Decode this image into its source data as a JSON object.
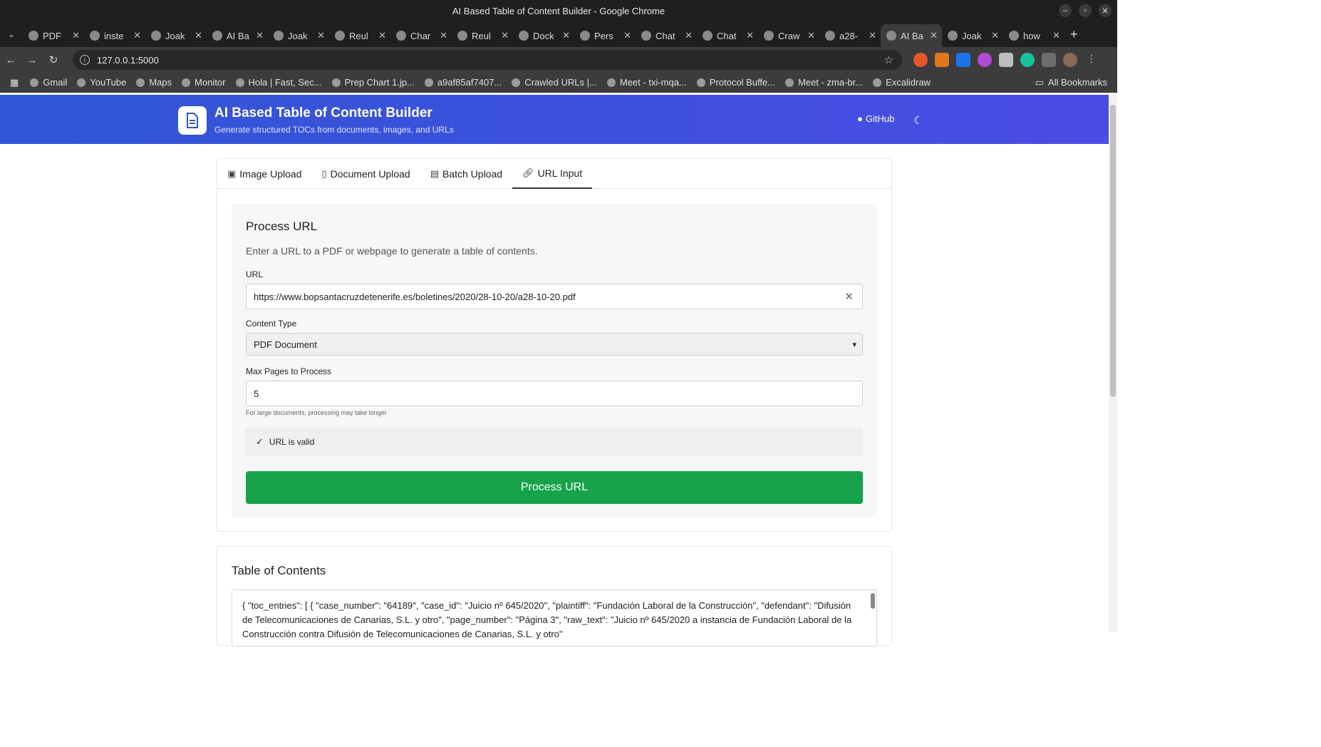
{
  "window": {
    "title": "AI Based Table of Content Builder - Google Chrome"
  },
  "tabs": [
    {
      "label": "PDF"
    },
    {
      "label": "inste"
    },
    {
      "label": "Joak"
    },
    {
      "label": "AI Ba"
    },
    {
      "label": "Joak"
    },
    {
      "label": "Reul"
    },
    {
      "label": "Char"
    },
    {
      "label": "Reul"
    },
    {
      "label": "Dock"
    },
    {
      "label": "Pers"
    },
    {
      "label": "Chat"
    },
    {
      "label": "Chat"
    },
    {
      "label": "Craw"
    },
    {
      "label": "a28-"
    },
    {
      "label": "AI Ba"
    },
    {
      "label": "Joak"
    },
    {
      "label": "how"
    }
  ],
  "active_tab_index": 14,
  "browser": {
    "url": "127.0.0.1:5000"
  },
  "bookmarks": [
    {
      "label": "Gmail"
    },
    {
      "label": "YouTube"
    },
    {
      "label": "Maps"
    },
    {
      "label": "Monitor"
    },
    {
      "label": "Hola | Fast, Sec..."
    },
    {
      "label": "Prep Chart 1.jp..."
    },
    {
      "label": "a9af85af7407..."
    },
    {
      "label": "Crawled URLs |..."
    },
    {
      "label": "Meet - txi-mqa..."
    },
    {
      "label": "Protocol Buffe..."
    },
    {
      "label": "Meet - zma-br..."
    },
    {
      "label": "Excalidraw"
    }
  ],
  "bookmarks_all": "All Bookmarks",
  "app": {
    "title": "AI Based Table of Content Builder",
    "subtitle": "Generate structured TOCs from documents, images, and URLs",
    "github": "GitHub",
    "accent": "#2f56d6"
  },
  "nav_tabs": [
    {
      "label": "Image Upload",
      "icon": "image-icon"
    },
    {
      "label": "Document Upload",
      "icon": "document-icon"
    },
    {
      "label": "Batch Upload",
      "icon": "batch-icon"
    },
    {
      "label": "URL Input",
      "icon": "link-icon"
    }
  ],
  "panel": {
    "title": "Process URL",
    "description": "Enter a URL to a PDF or webpage to generate a table of contents.",
    "url_label": "URL",
    "url_value": "https://www.bopsantacruzdetenerife.es/boletines/2020/28-10-20/a28-10-20.pdf",
    "content_type_label": "Content Type",
    "content_type_value": "PDF Document",
    "max_pages_label": "Max Pages to Process",
    "max_pages_value": "5",
    "hint": "For large documents, processing may take longer",
    "valid_text": "URL is valid",
    "process_button": "Process URL",
    "button_color": "#16a34a"
  },
  "toc": {
    "title": "Table of Contents",
    "content": "{ \"toc_entries\": [ { \"case_number\": \"64189\", \"case_id\": \"Juicio nº 645/2020\", \"plaintiff\": \"Fundación Laboral de la Construcción\", \"defendant\": \"Difusión de Telecomunicaciones de Canarias, S.L. y otro\", \"page_number\": \"Página 3\", \"raw_text\": \"Juicio nº 645/2020 a instancia de Fundación Laboral de la Construcción contra Difusión de Telecomunicaciones de Canarias, S.L. y otro\""
  }
}
